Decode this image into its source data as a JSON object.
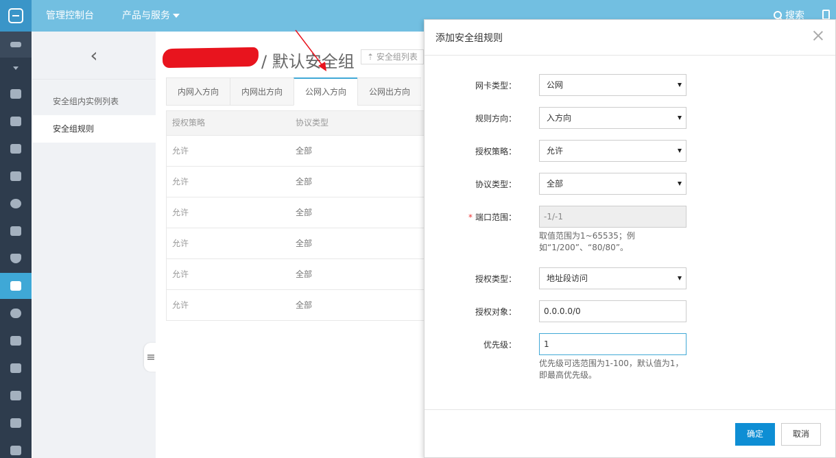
{
  "topbar": {
    "console_label": "管理控制台",
    "products_label": "产品与服务",
    "search_label": "搜索"
  },
  "subnav": {
    "items": [
      {
        "label": "安全组内实例列表",
        "active": false
      },
      {
        "label": "安全组规则",
        "active": true
      }
    ]
  },
  "page": {
    "title": "/ 默认安全组",
    "back_list_label": "安全组列表",
    "tabs": [
      {
        "label": "内网入方向",
        "active": false
      },
      {
        "label": "内网出方向",
        "active": false
      },
      {
        "label": "公网入方向",
        "active": true
      },
      {
        "label": "公网出方向",
        "active": false
      }
    ],
    "table": {
      "headers": [
        "授权策略",
        "协议类型"
      ],
      "rows": [
        [
          "允许",
          "全部"
        ],
        [
          "允许",
          "全部"
        ],
        [
          "允许",
          "全部"
        ],
        [
          "允许",
          "全部"
        ],
        [
          "允许",
          "全部"
        ],
        [
          "允许",
          "全部"
        ]
      ]
    }
  },
  "dialog": {
    "title": "添加安全组规则",
    "fields": {
      "nic_type": {
        "label": "网卡类型：",
        "value": "公网"
      },
      "direction": {
        "label": "规则方向：",
        "value": "入方向"
      },
      "policy": {
        "label": "授权策略：",
        "value": "允许"
      },
      "protocol": {
        "label": "协议类型：",
        "value": "全部"
      },
      "port_range": {
        "label": "端口范围：",
        "value": "-1/-1",
        "help": "取值范围为1~65535；例如“1/200”、“80/80”。"
      },
      "auth_type": {
        "label": "授权类型：",
        "value": "地址段访问"
      },
      "auth_object": {
        "label": "授权对象：",
        "value": "0.0.0.0/0"
      },
      "priority": {
        "label": "优先级：",
        "value": "1",
        "help": "优先级可选范围为1-100，默认值为1，即最高优先级。"
      }
    },
    "required_mark": "*",
    "ok_label": "确定",
    "cancel_label": "取消"
  },
  "colors": {
    "topbar": "#72bfe1",
    "accent": "#0e8ed4",
    "iconbar": "#2e3c4d",
    "annotation_arrow": "#e8141e"
  }
}
